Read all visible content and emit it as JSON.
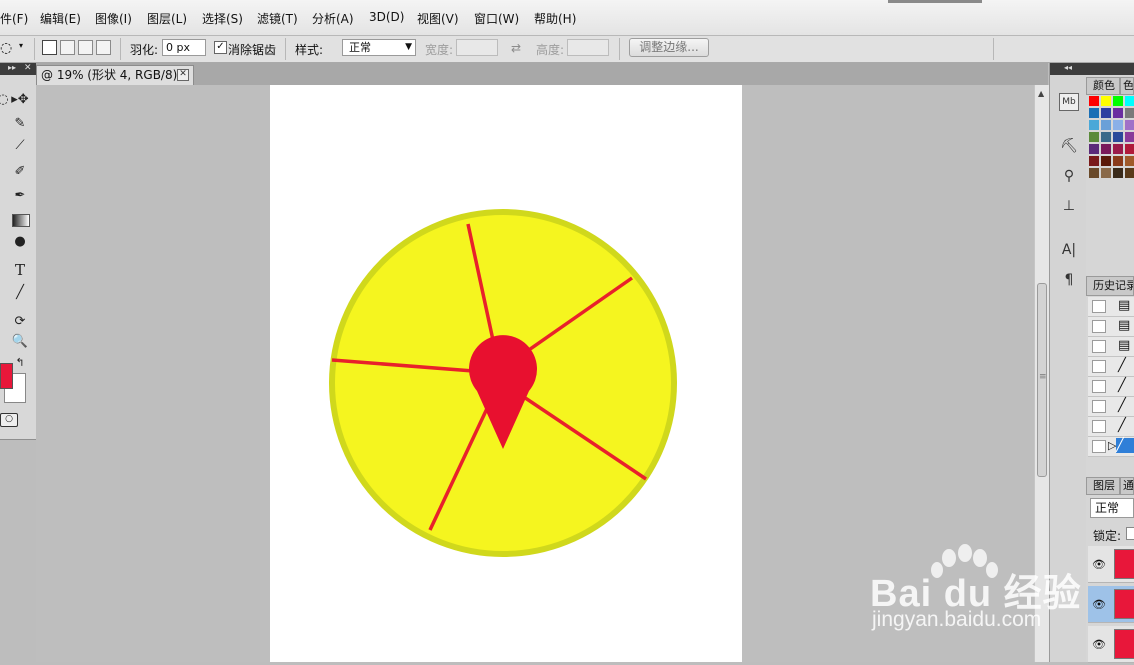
{
  "menubar": {
    "items": [
      "件(F)",
      "编辑(E)",
      "图像(I)",
      "图层(L)",
      "选择(S)",
      "滤镜(T)",
      "分析(A)",
      "3D(D)",
      "视图(V)",
      "窗口(W)",
      "帮助(H)"
    ]
  },
  "options": {
    "feather_label": "羽化:",
    "feather_value": "0 px",
    "antialias_label": "消除锯齿",
    "antialias_checked": true,
    "style_label": "样式:",
    "style_value": "正常",
    "width_label": "宽度:",
    "height_label": "高度:",
    "refine_button": "调整边缘..."
  },
  "document": {
    "tab_title": "@ 19% (形状 4, RGB/8) *"
  },
  "tools": {
    "text_tool": "T",
    "foreground_color": "#e8173a",
    "background_color": "#ffffff"
  },
  "panels": {
    "color_tab": "颜色",
    "color_tab_2": "色",
    "history_tab": "历史记录",
    "layers_tab": "图层",
    "layers_tab_2": "通",
    "blend_mode": "正常",
    "lock_label": "锁定:",
    "strip_icon_mb": "Mb",
    "strip_icon_a": "A|",
    "strip_icon_para": "¶"
  },
  "artwork": {
    "circle_fill": "#f5f51f",
    "circle_stroke": "#d0d81c",
    "spoke_color": "#e8212b",
    "pin_color": "#e8102f"
  },
  "watermark": {
    "brand": "Bai du 经验",
    "url": "jingyan.baidu.com"
  }
}
